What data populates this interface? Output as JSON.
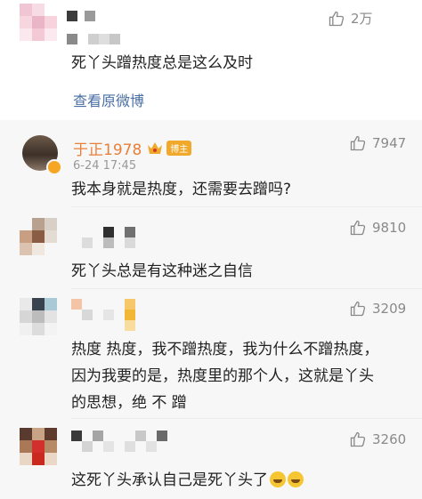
{
  "top_comment": {
    "likes": "2万",
    "text": "死丫头蹭热度总是这么及时",
    "view_original": "查看原微博"
  },
  "replies": [
    {
      "username": "于正1978",
      "badge": "博主",
      "time": "6-24 17:45",
      "likes": "7947",
      "text": "我本身就是热度，还需要去蹭吗?"
    },
    {
      "likes": "9810",
      "text": "死丫头总是有这种迷之自信"
    },
    {
      "likes": "3209",
      "lines": [
        "热度 热度，我不蹭热度，我为什么不蹭热度，",
        "因为我要的是，热度里的那个人，这就是丫头",
        "的思想，绝 不 蹭"
      ]
    },
    {
      "likes": "3260",
      "text": "这死丫头承认自己是死丫头了"
    }
  ],
  "icons": {
    "like": "thumbs-up-icon",
    "crown": "crown-icon",
    "emoji": "laughing-tears-emoji-icon"
  },
  "colors": {
    "username": "#e8803a",
    "link": "#4a6fa5",
    "reply_background": "#f7f7f7"
  }
}
